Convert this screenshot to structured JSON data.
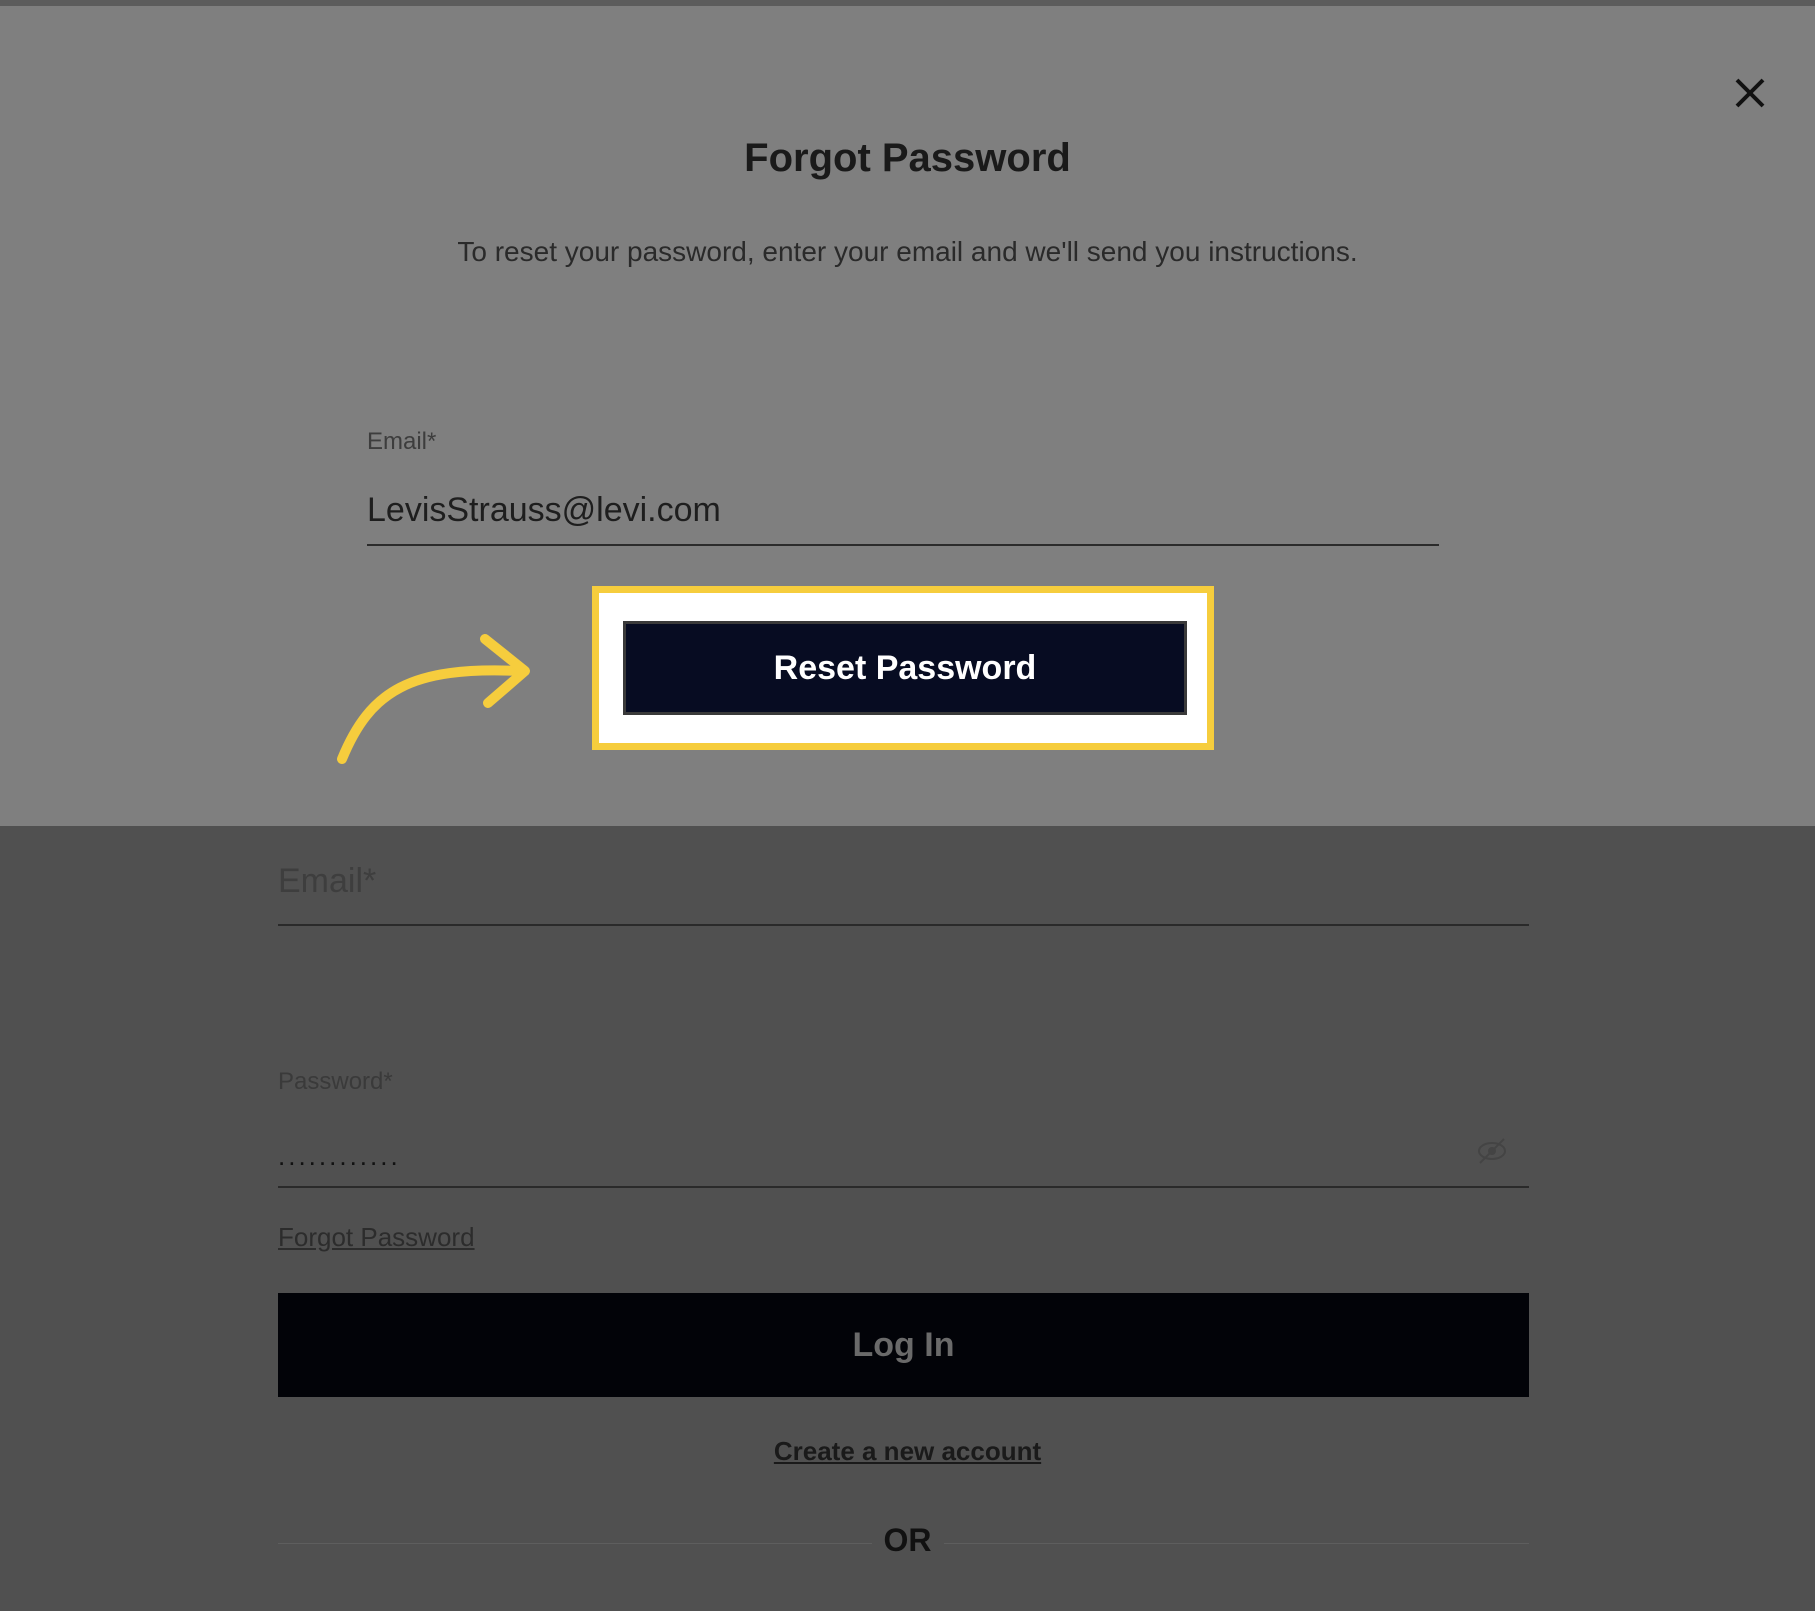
{
  "modal": {
    "title": "Forgot Password",
    "description": "To reset your password, enter your email and we'll send you instructions.",
    "email_label": "Email*",
    "email_value": "LevisStrauss@levi.com",
    "reset_button": "Reset Password",
    "close_icon": "close-icon",
    "highlight_color": "#f6cd3d",
    "arrow_icon": "curved-arrow-icon"
  },
  "login_form": {
    "email_label": "Email*",
    "password_label": "Password*",
    "password_value": "............",
    "eye_icon": "eye-slash-icon",
    "forgot_link": "Forgot Password",
    "login_button": "Log In",
    "create_account_link": "Create a new account",
    "or_divider": "OR"
  }
}
